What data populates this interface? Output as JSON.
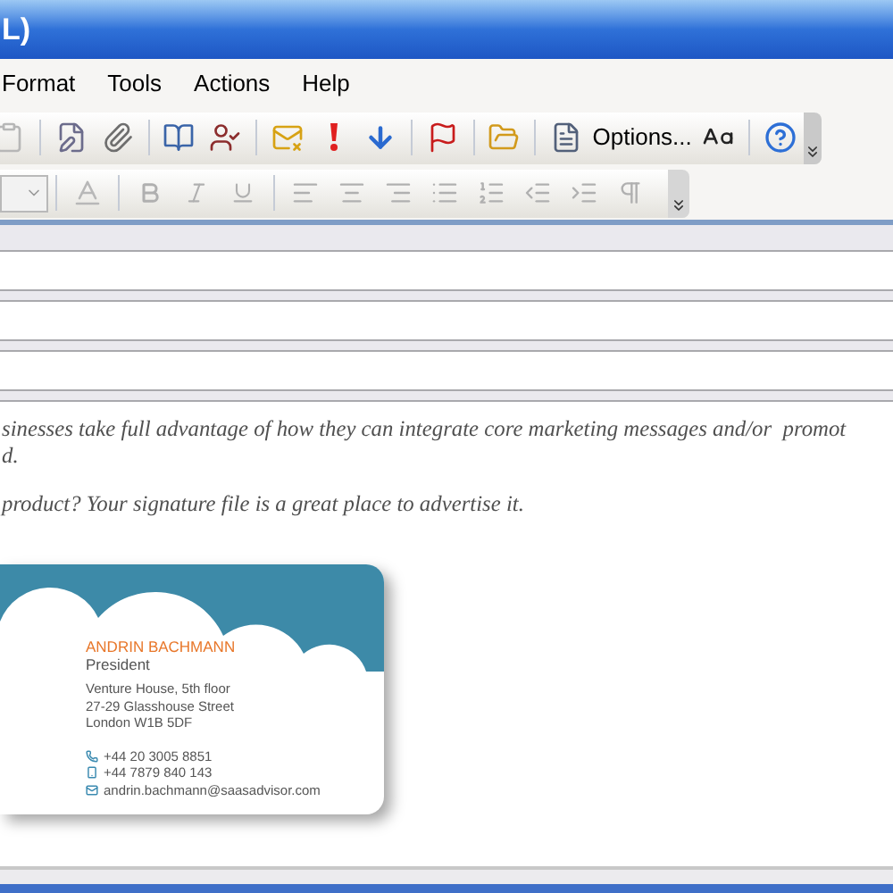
{
  "window": {
    "title": "L)"
  },
  "menu": [
    "Format",
    "Tools",
    "Actions",
    "Help"
  ],
  "toolbar": {
    "options_label": "Options..."
  },
  "message": {
    "paragraphs": [
      "sinesses take full advantage of how they can integrate core marketing messages and/or  promot\nd.",
      "product? Your signature file is a great place to advertise it."
    ]
  },
  "signature": {
    "name": "ANDRIN BACHMANN",
    "role": "President",
    "address": [
      "Venture House, 5th floor",
      "27-29 Glasshouse Street",
      "London W1B 5DF"
    ],
    "contacts": [
      {
        "kind": "phone",
        "text": "+44 20 3005 8851"
      },
      {
        "kind": "mobile",
        "text": "+44 7879 840 143"
      },
      {
        "kind": "email",
        "text": "andrin.bachmann@saasadvisor.com"
      }
    ]
  }
}
